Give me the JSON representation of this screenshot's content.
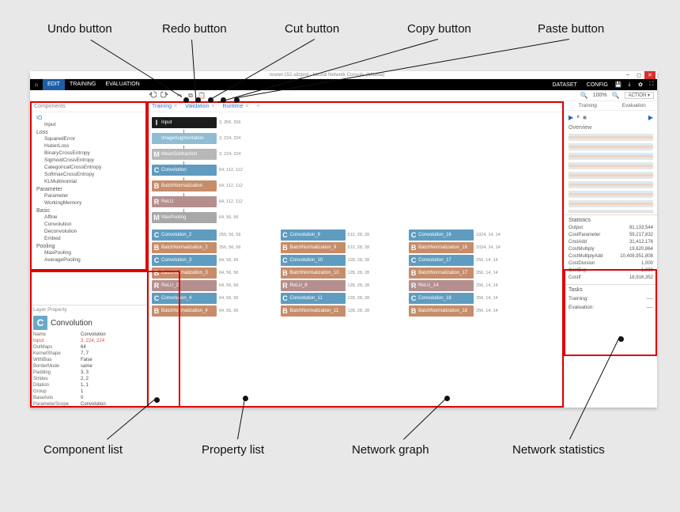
{
  "callouts": {
    "undo": "Undo button",
    "redo": "Redo button",
    "cut": "Cut button",
    "copy": "Copy button",
    "paste": "Paste button",
    "component_list": "Component list",
    "property_list": "Property list",
    "network_graph": "Network graph",
    "network_statistics": "Network statistics"
  },
  "window": {
    "title": "resnet-152.sdcproj - Neural Network Console (NNabla)"
  },
  "menubar": {
    "edit": "EDIT",
    "training": "TRAINING",
    "evaluation": "EVALUATION",
    "dataset": "DATASET",
    "config": "CONFIG"
  },
  "toolbar": {
    "zoom": "100%",
    "action": "ACTION"
  },
  "components": {
    "title": "Components",
    "cat_io": "IO",
    "io_input": "Input",
    "cat_loss": "Loss",
    "loss": [
      "SquaredError",
      "HuberLoss",
      "BinaryCrossEntropy",
      "SigmoidCrossEntropy",
      "CategoricalCrossEntropy",
      "SoftmaxCrossEntropy",
      "KLMultinomial"
    ],
    "cat_parameter": "Parameter",
    "param": [
      "Parameter",
      "WorkingMemory"
    ],
    "cat_basic": "Basic",
    "basic": [
      "Affine",
      "Convolution",
      "Deconvolution",
      "Embed"
    ],
    "cat_pooling": "Pooling",
    "pool": [
      "MaxPooling",
      "AveragePooling"
    ]
  },
  "layer_property": {
    "title": "Layer Property",
    "name": "Convolution",
    "rows": [
      {
        "k": "Name",
        "v": "Convolution"
      },
      {
        "k": "Input",
        "v": "3, 224, 224",
        "hi": true
      },
      {
        "k": "OutMaps",
        "v": "64"
      },
      {
        "k": "KernelShape",
        "v": "7, 7"
      },
      {
        "k": "WithBias",
        "v": "False"
      },
      {
        "k": "BorderMode",
        "v": "same"
      },
      {
        "k": "Padding",
        "v": "3, 3"
      },
      {
        "k": "Strides",
        "v": "2, 2"
      },
      {
        "k": "Dilation",
        "v": "1, 1"
      },
      {
        "k": "Group",
        "v": "1"
      },
      {
        "k": "BaseAxis",
        "v": "0"
      },
      {
        "k": "ParameterScope",
        "v": "Convolution"
      }
    ]
  },
  "subtabs": {
    "training": "Training",
    "validation": "Validation",
    "runtime": "Runtime"
  },
  "graph": {
    "top": [
      {
        "cls": "c-input",
        "tag": "I",
        "lbl": "Input",
        "dims": "3, 256, 256"
      },
      {
        "cls": "c-aug",
        "tag": "",
        "lbl": "ImageAugmentation",
        "dims": "3, 224, 224"
      },
      {
        "cls": "c-mean",
        "tag": "M",
        "lbl": "MeanSubtraction",
        "dims": "3, 224, 224"
      },
      {
        "cls": "c-conv",
        "tag": "C",
        "lbl": "Convolution",
        "dims": "64, 112, 112"
      },
      {
        "cls": "c-bn",
        "tag": "B",
        "lbl": "BatchNormalization",
        "dims": "64, 112, 112"
      },
      {
        "cls": "c-relu",
        "tag": "R",
        "lbl": "ReLU",
        "dims": "64, 112, 112"
      },
      {
        "cls": "c-pool",
        "tag": "M",
        "lbl": "MaxPooling",
        "dims": "64, 56, 56"
      }
    ],
    "col1": [
      {
        "cls": "c-conv",
        "tag": "C",
        "lbl": "Convolution_2",
        "dims": "256, 56, 56"
      },
      {
        "cls": "c-bn",
        "tag": "B",
        "lbl": "BatchNormalization_2",
        "dims": "256, 56, 56"
      },
      {
        "cls": "c-conv",
        "tag": "C",
        "lbl": "Convolution_3",
        "dims": "64, 56, 56"
      },
      {
        "cls": "c-bn",
        "tag": "B",
        "lbl": "BatchNormalization_3",
        "dims": "64, 56, 56"
      },
      {
        "cls": "c-relu",
        "tag": "R",
        "lbl": "ReLU_2",
        "dims": "64, 56, 56"
      },
      {
        "cls": "c-conv",
        "tag": "C",
        "lbl": "Convolution_4",
        "dims": "64, 56, 56"
      },
      {
        "cls": "c-bn",
        "tag": "B",
        "lbl": "BatchNormalization_4",
        "dims": "64, 56, 56"
      }
    ],
    "col2": [
      {
        "cls": "c-conv",
        "tag": "C",
        "lbl": "Convolution_9",
        "dims": "512, 28, 28"
      },
      {
        "cls": "c-bn",
        "tag": "B",
        "lbl": "BatchNormalization_9",
        "dims": "512, 28, 28"
      },
      {
        "cls": "c-conv",
        "tag": "C",
        "lbl": "Convolution_10",
        "dims": "128, 28, 28"
      },
      {
        "cls": "c-bn",
        "tag": "B",
        "lbl": "BatchNormalization_10",
        "dims": "128, 28, 28"
      },
      {
        "cls": "c-relu",
        "tag": "R",
        "lbl": "ReLU_8",
        "dims": "128, 28, 28"
      },
      {
        "cls": "c-conv",
        "tag": "C",
        "lbl": "Convolution_11",
        "dims": "128, 28, 28"
      },
      {
        "cls": "c-bn",
        "tag": "B",
        "lbl": "BatchNormalization_11",
        "dims": "128, 28, 28"
      }
    ],
    "col3": [
      {
        "cls": "c-conv",
        "tag": "C",
        "lbl": "Convolution_16",
        "dims": "1024, 14, 14"
      },
      {
        "cls": "c-bn",
        "tag": "B",
        "lbl": "BatchNormalization_16",
        "dims": "1024, 14, 14"
      },
      {
        "cls": "c-conv",
        "tag": "C",
        "lbl": "Convolution_17",
        "dims": "256, 14, 14"
      },
      {
        "cls": "c-bn",
        "tag": "B",
        "lbl": "BatchNormalization_17",
        "dims": "256, 14, 14"
      },
      {
        "cls": "c-relu",
        "tag": "R",
        "lbl": "ReLU_14",
        "dims": "256, 14, 14"
      },
      {
        "cls": "c-conv",
        "tag": "C",
        "lbl": "Convolution_18",
        "dims": "256, 14, 14"
      },
      {
        "cls": "c-bn",
        "tag": "B",
        "lbl": "BatchNormalization_18",
        "dims": "256, 14, 14"
      }
    ]
  },
  "right": {
    "tab_train": "Training",
    "tab_eval": "Evaluation",
    "overview": "Overview",
    "stats_title": "Statistics",
    "stats": [
      {
        "k": "Output",
        "v": "81,133,544"
      },
      {
        "k": "CostParameter",
        "v": "59,217,832"
      },
      {
        "k": "CostAdd",
        "v": "31,412,176"
      },
      {
        "k": "CostMultiply",
        "v": "19,620,864"
      },
      {
        "k": "CostMultiplyAdd",
        "v": "10,408,951,808"
      },
      {
        "k": "CostDivision",
        "v": "1,000"
      },
      {
        "k": "CostExp",
        "v": "1,000"
      },
      {
        "k": "CostIf",
        "v": "18,916,352"
      }
    ],
    "tasks_title": "Tasks",
    "task_train": "Training:",
    "task_eval": "Evaluation:",
    "dash": "----"
  }
}
